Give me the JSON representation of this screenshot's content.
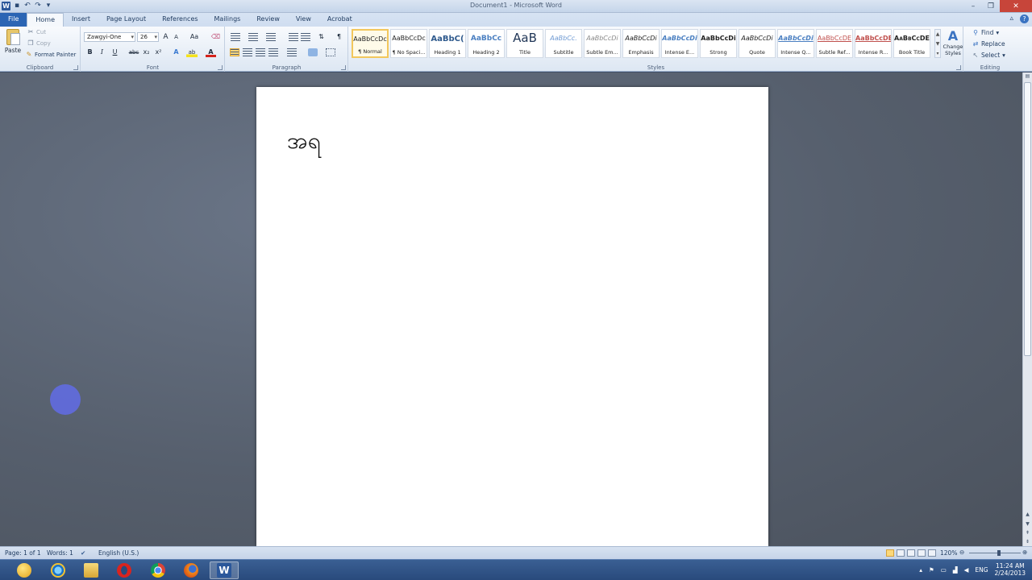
{
  "window": {
    "title": "Document1 - Microsoft Word",
    "app_icon": "W"
  },
  "tabs": [
    "File",
    "Home",
    "Insert",
    "Page Layout",
    "References",
    "Mailings",
    "Review",
    "View",
    "Acrobat"
  ],
  "active_tab": "Home",
  "clipboard": {
    "paste": "Paste",
    "cut": "Cut",
    "copy": "Copy",
    "format_painter": "Format Painter",
    "label": "Clipboard"
  },
  "font": {
    "name": "Zawgyi-One",
    "size": "26",
    "label": "Font",
    "bold": "B",
    "italic": "I",
    "underline": "U",
    "strike": "abc",
    "sub": "x₂",
    "sup": "x²",
    "grow": "A",
    "shrink": "A",
    "case": "Aa",
    "effects": "A",
    "highlight": "ab",
    "color": "A"
  },
  "paragraph": {
    "label": "Paragraph",
    "pilcrow": "¶"
  },
  "styles": {
    "label": "Styles",
    "items": [
      {
        "preview": "AaBbCcDc",
        "name": "¶ Normal"
      },
      {
        "preview": "AaBbCcDc",
        "name": "¶ No Spaci..."
      },
      {
        "preview": "AaBbC(",
        "name": "Heading 1"
      },
      {
        "preview": "AaBbCc",
        "name": "Heading 2"
      },
      {
        "preview": "AaB",
        "name": "Title"
      },
      {
        "preview": "AaBbCc.",
        "name": "Subtitle"
      },
      {
        "preview": "AaBbCcDi",
        "name": "Subtle Em..."
      },
      {
        "preview": "AaBbCcDi",
        "name": "Emphasis"
      },
      {
        "preview": "AaBbCcDi",
        "name": "Intense E..."
      },
      {
        "preview": "AaBbCcDi",
        "name": "Strong"
      },
      {
        "preview": "AaBbCcDi",
        "name": "Quote"
      },
      {
        "preview": "AaBbCcDi",
        "name": "Intense Q..."
      },
      {
        "preview": "AaBbCcDE",
        "name": "Subtle Ref..."
      },
      {
        "preview": "AaBbCcDE",
        "name": "Intense R..."
      },
      {
        "preview": "AaBbCcDE",
        "name": "Book Title"
      }
    ],
    "change_styles_1": "Change",
    "change_styles_2": "Styles"
  },
  "editing": {
    "find": "Find",
    "replace": "Replace",
    "select": "Select",
    "label": "Editing"
  },
  "document": {
    "text": "အရ"
  },
  "status": {
    "page": "Page: 1 of 1",
    "words": "Words: 1",
    "language": "English (U.S.)",
    "zoom": "120%",
    "zoom_fraction": 0.58
  },
  "tray": {
    "lang": "ENG",
    "time": "11:24 AM",
    "date": "2/24/2013"
  },
  "colors": {
    "accent": "#2b579a",
    "file_tab": "#2b65b4",
    "selection": "#f2c75c",
    "pointer": "#626ce6"
  }
}
